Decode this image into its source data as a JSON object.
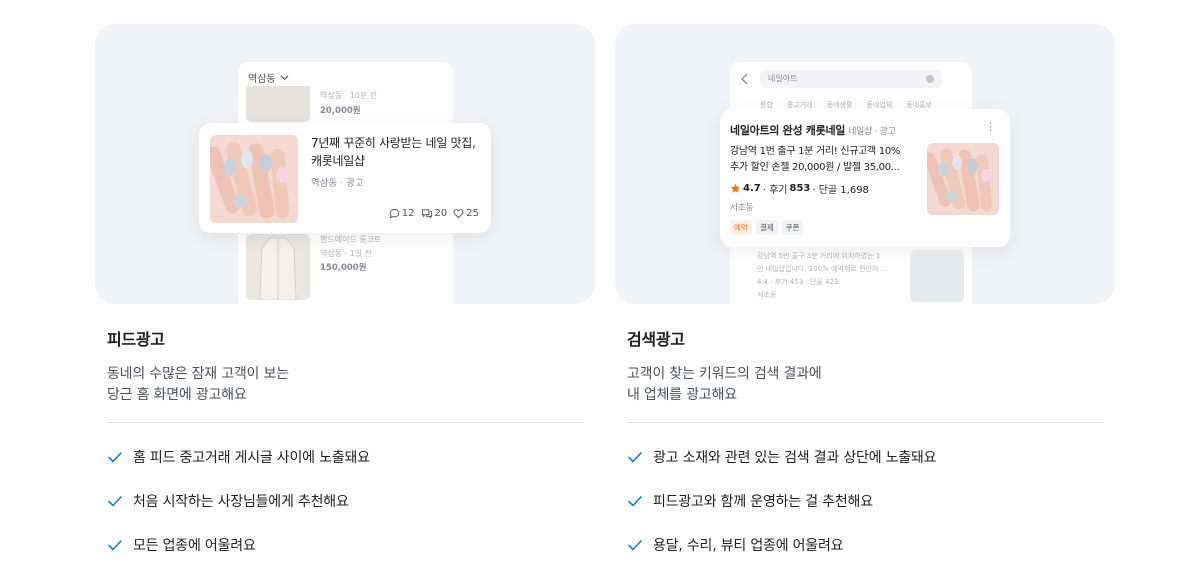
{
  "left": {
    "mock": {
      "location": "역삼동",
      "ghost1_meta": "역삼동 · 10분 전",
      "ghost1_price": "20,000원",
      "ghost2_title": "핸드메이드 롱코트",
      "ghost2_meta": "역삼동 · 1일 전",
      "ghost2_price": "150,000원",
      "card_title": "7년째 꾸준히 사랑받는 네일 맛집, 캐롯네일샵",
      "card_sub": "역삼동 · 광고",
      "comments": "12",
      "chats": "20",
      "likes": "25"
    },
    "title": "피드광고",
    "desc": "동네의 수많은 잠재 고객이 보는\n당근 홈 화면에 광고해요",
    "points": [
      "홈 피드 중고거래 게시글 사이에 노출돼요",
      "처음 시작하는 사장님들에게 추천해요",
      "모든 업종에 어울려요"
    ]
  },
  "right": {
    "mock": {
      "search_query": "네일아트",
      "tabs": [
        "통합",
        "중고거래",
        "동네생활",
        "동네업체",
        "동네홍보"
      ],
      "card_title": "네일아트의 완성 캐롯네일",
      "card_category": "네일샵 · 광고",
      "card_desc": "강남역 1번 출구 1분 거리! 신규고객 10%\n추가 할인 손젤 20,000원 / 발젤 35,00...",
      "rating": "4.7",
      "review_label": "· 후기",
      "reviews": "853",
      "regulars": "· 단골 1,698",
      "area": "서초동",
      "tags": [
        "예약",
        "결제",
        "쿠폰"
      ],
      "ghost_desc": "강남역 5번 출구 3분 거리에 위치하였는 1\n인 네일샵입니다. 100% 예약제로 편안히 ...",
      "ghost_rating": "4.4 · 후기 453 · 단골 423",
      "ghost_area": "서초동"
    },
    "title": "검색광고",
    "desc": "고객이 찾는 키워드의 검색 결과에\n내 업체를 광고해요",
    "points": [
      "광고 소재와 관련 있는 검색 결과 상단에 노출돼요",
      "피드광고와 함께 운영하는 걸 추천해요",
      "용달, 수리, 뷰티 업종에 어울려요"
    ]
  },
  "colors": {
    "accent": "#1a7eb8",
    "orange": "#ff6f0f",
    "hero_bg": "#f2f3f6"
  }
}
